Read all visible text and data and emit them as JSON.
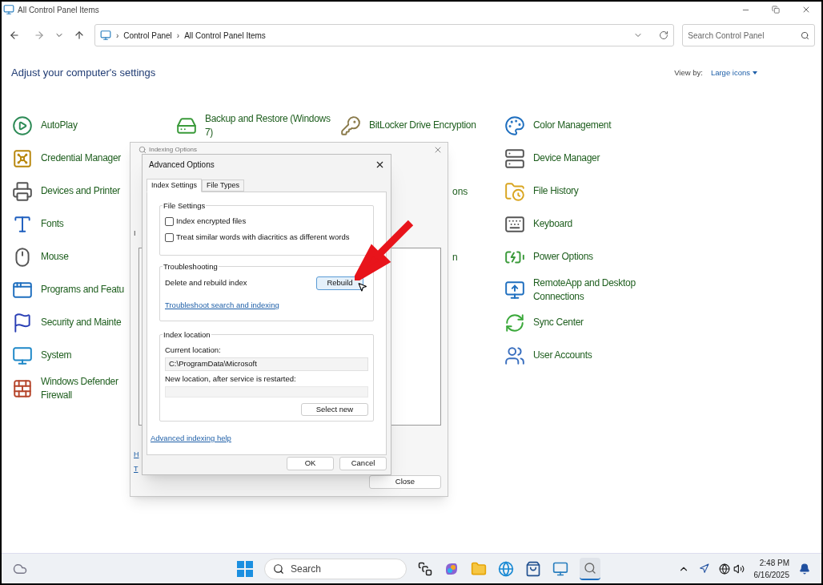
{
  "window": {
    "title": "All Control Panel Items"
  },
  "address": {
    "separator": "›",
    "crumbs": [
      "Control Panel",
      "All Control Panel Items"
    ]
  },
  "search": {
    "placeholder": "Search Control Panel"
  },
  "heading": "Adjust your computer's settings",
  "view_by": {
    "label": "View by:",
    "value": "Large icons"
  },
  "columns": [
    [
      {
        "kind": "item",
        "label": "AutoPlay"
      },
      {
        "kind": "item",
        "label": "Credential Manager"
      },
      {
        "kind": "item",
        "label": "Devices and Printer"
      },
      {
        "kind": "item",
        "label": "Fonts"
      },
      {
        "kind": "item",
        "label": "Mouse"
      },
      {
        "kind": "item",
        "label": "Programs and Featu"
      },
      {
        "kind": "item",
        "label": "Security and Mainte"
      },
      {
        "kind": "item",
        "label": "System"
      },
      {
        "kind": "item",
        "label": "Windows Defender Firewall"
      }
    ],
    [
      {
        "kind": "item",
        "label": "Backup and Restore (Windows 7)"
      }
    ],
    [
      {
        "kind": "item",
        "label": "BitLocker Drive Encryption"
      },
      {
        "kind": "hidden"
      },
      {
        "kind": "cut",
        "label": "ons"
      },
      {
        "kind": "hidden"
      },
      {
        "kind": "cut",
        "label": "n"
      }
    ],
    [
      {
        "kind": "item",
        "label": "Color Management"
      },
      {
        "kind": "item",
        "label": "Device Manager"
      },
      {
        "kind": "item",
        "label": "File History"
      },
      {
        "kind": "item",
        "label": "Keyboard"
      },
      {
        "kind": "item",
        "label": "Power Options"
      },
      {
        "kind": "item",
        "label": "RemoteApp and Desktop Connections"
      },
      {
        "kind": "item",
        "label": "Sync Center"
      },
      {
        "kind": "item",
        "label": "User Accounts"
      }
    ]
  ],
  "indexing_dialog": {
    "title": "Indexing Options",
    "cut_letters": [
      "I",
      "H",
      "T"
    ],
    "close_button": "Close"
  },
  "advanced_dialog": {
    "title": "Advanced Options",
    "tabs": [
      {
        "label": "Index Settings",
        "selected": true
      },
      {
        "label": "File Types",
        "selected": false
      }
    ],
    "file_settings": {
      "title": "File Settings",
      "options": [
        {
          "label": "Index encrypted files",
          "checked": false
        },
        {
          "label": "Treat similar words with diacritics as different words",
          "checked": false
        }
      ]
    },
    "troubleshooting": {
      "title": "Troubleshooting",
      "text": "Delete and rebuild index",
      "button": "Rebuild",
      "link": "Troubleshoot search and indexing"
    },
    "index_location": {
      "title": "Index location",
      "current_label": "Current location:",
      "current_value": "C:\\ProgramData\\Microsoft",
      "new_label": "New location, after service is restarted:",
      "button": "Select new"
    },
    "help_link": "Advanced indexing help",
    "buttons": [
      "OK",
      "Cancel"
    ]
  },
  "taskbar": {
    "search_placeholder": "Search",
    "time": "2:48 PM",
    "date": "6/16/2025"
  }
}
